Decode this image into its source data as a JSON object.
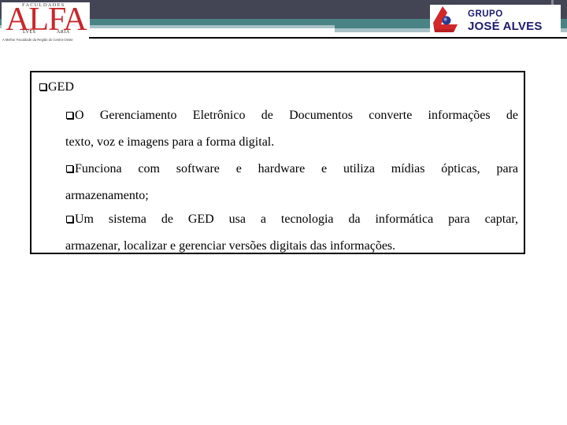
{
  "header": {
    "left_logo": {
      "top_text": "FACULDADES",
      "main_text": "ALFA",
      "sub_left": "LVES",
      "sub_right": "ARIA",
      "tagline": "A Melhor Faculdade da Região do Centro-Oeste"
    },
    "right_logo": {
      "line1": "GRUPO",
      "line2": "JOSÉ ALVES"
    },
    "colors": {
      "dark_band": "#434454",
      "teal_band": "#4a8385",
      "light_band": "#a8c1c6",
      "logo_red": "#c8282c",
      "logo_navy": "#1c1a6e"
    }
  },
  "content": {
    "title": "GED",
    "bullets": [
      {
        "lines": [
          "O Gerenciamento Eletrônico de Documentos converte informações de",
          "texto, voz e imagens para a forma digital."
        ]
      },
      {
        "lines": [
          "Funciona com software e hardware e utiliza mídias ópticas, para",
          "armazenamento;"
        ]
      },
      {
        "lines": [
          "Um sistema de GED usa a tecnologia da informática para captar,",
          "armazenar, localizar e gerenciar versões digitais das informações."
        ]
      }
    ]
  }
}
